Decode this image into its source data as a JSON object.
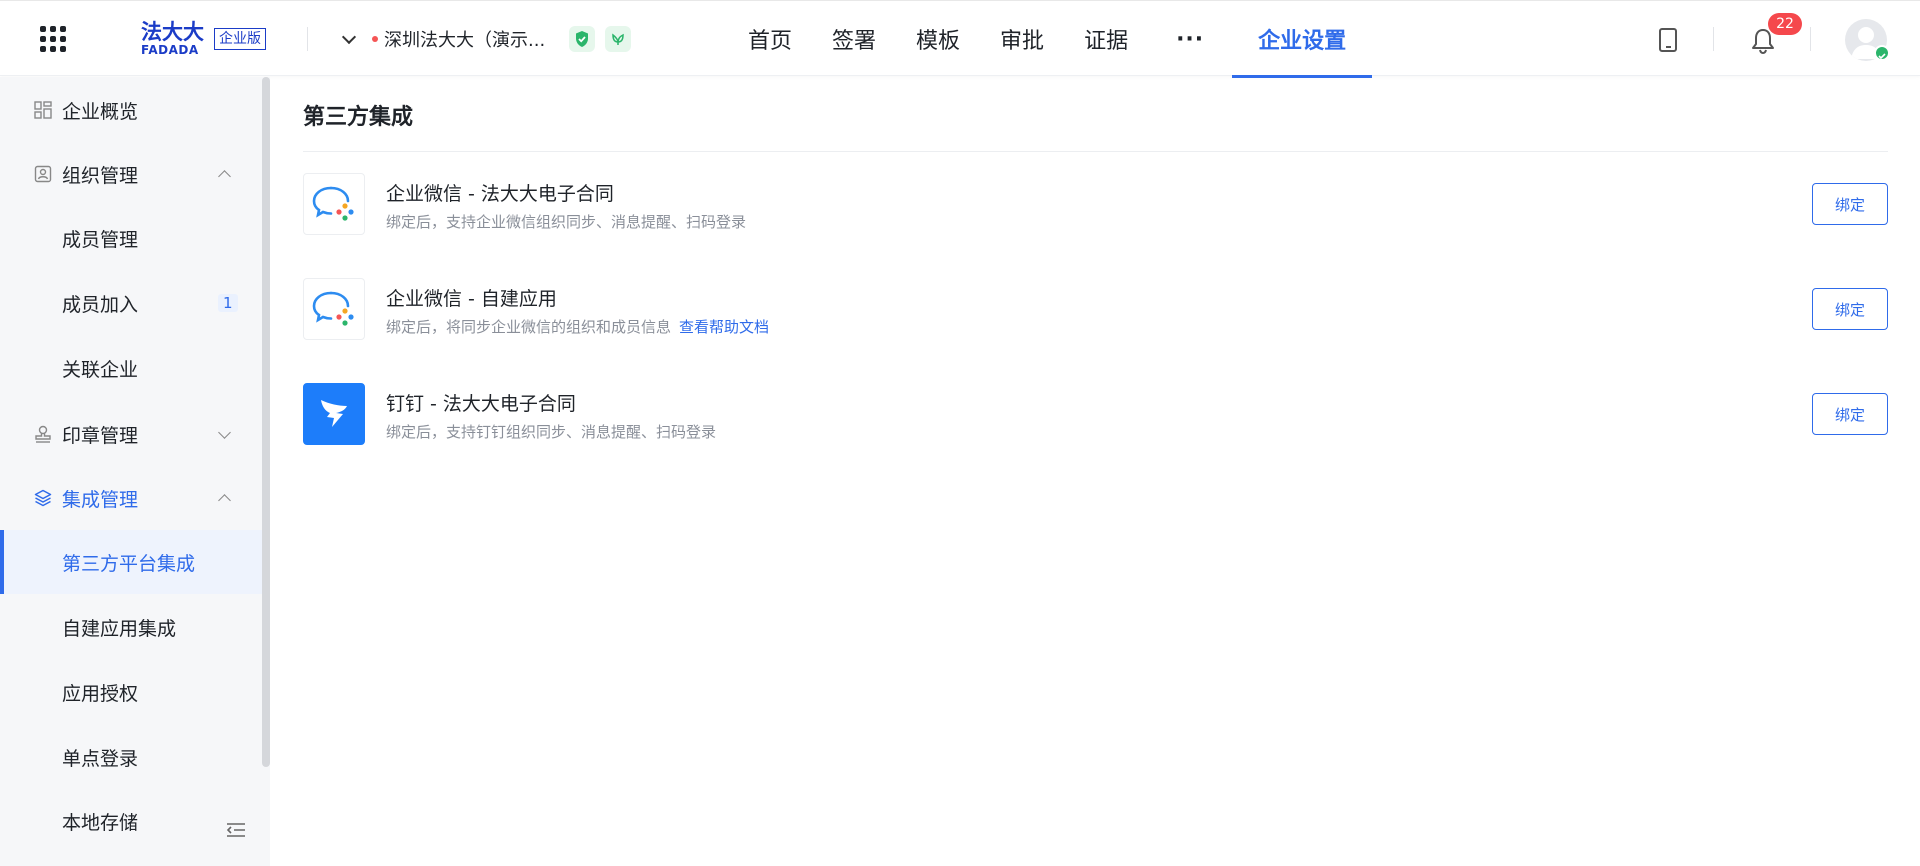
{
  "header": {
    "logo_cn": "法大大",
    "logo_en": "FADADA",
    "edition": "企业版",
    "company": "深圳法大大（演示...",
    "nav": [
      "首页",
      "签署",
      "模板",
      "审批",
      "证据",
      "···",
      "企业设置"
    ],
    "active_nav": "企业设置",
    "notification_count": "22"
  },
  "sidebar": {
    "items": [
      {
        "label": "企业概览",
        "icon": "overview-icon"
      },
      {
        "label": "组织管理",
        "icon": "org-icon",
        "caret": "up"
      },
      {
        "label": "成员管理"
      },
      {
        "label": "成员加入",
        "count": "1"
      },
      {
        "label": "关联企业"
      },
      {
        "label": "印章管理",
        "icon": "seal-icon",
        "caret": "down"
      },
      {
        "label": "集成管理",
        "icon": "layers-icon",
        "caret": "up"
      },
      {
        "label": "第三方平台集成",
        "active": true
      },
      {
        "label": "自建应用集成"
      },
      {
        "label": "应用授权"
      },
      {
        "label": "单点登录"
      },
      {
        "label": "本地存储"
      }
    ]
  },
  "main": {
    "title": "第三方集成",
    "integrations": [
      {
        "title": "企业微信 - 法大大电子合同",
        "desc": "绑定后，支持企业微信组织同步、消息提醒、扫码登录",
        "button": "绑定",
        "icon": "wecom-icon"
      },
      {
        "title": "企业微信 - 自建应用",
        "desc": "绑定后，将同步企业微信的组织和成员信息",
        "link": "查看帮助文档",
        "button": "绑定",
        "icon": "wecom-icon"
      },
      {
        "title": "钉钉 - 法大大电子合同",
        "desc": "绑定后，支持钉钉组织同步、消息提醒、扫码登录",
        "button": "绑定",
        "icon": "dingtalk-icon"
      }
    ]
  },
  "colors": {
    "accent": "#2f6bea",
    "brand": "#1b3cc7",
    "sidebar_bg": "#f6f7f9",
    "notification": "#f5484c"
  }
}
